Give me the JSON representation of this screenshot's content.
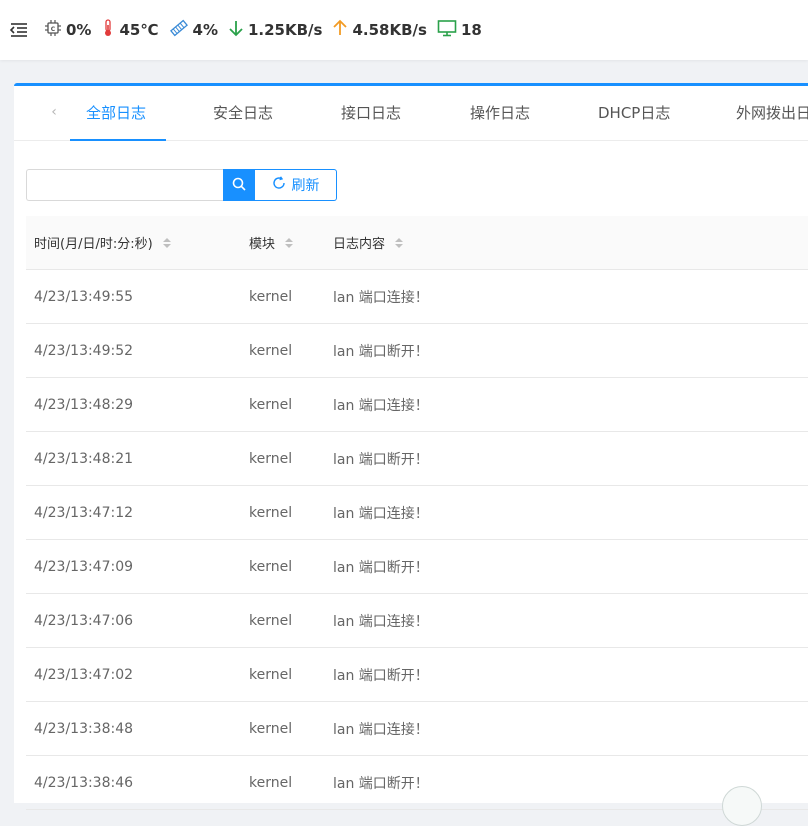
{
  "status_bar": {
    "cpu": "0%",
    "temperature": "45℃",
    "memory": "4%",
    "download": "1.25KB/s",
    "upload": "4.58KB/s",
    "devices": "18",
    "colors": {
      "temperature": "#e23b3b",
      "memory": "#3b8bd6",
      "download": "#2aa14a",
      "upload": "#f29b24",
      "devices": "#2aa14a"
    }
  },
  "tabs": [
    {
      "label": "全部日志",
      "active": true
    },
    {
      "label": "安全日志"
    },
    {
      "label": "接口日志"
    },
    {
      "label": "操作日志"
    },
    {
      "label": "DHCP日志"
    },
    {
      "label": "外网拨出日"
    }
  ],
  "search": {
    "value": "",
    "refresh_label": "刷新"
  },
  "table": {
    "columns": [
      "时间(月/日/时:分:秒)",
      "模块",
      "日志内容"
    ],
    "rows": [
      [
        "4/23/13:49:55",
        "kernel",
        "lan 端口连接！"
      ],
      [
        "4/23/13:49:52",
        "kernel",
        "lan 端口断开！"
      ],
      [
        "4/23/13:48:29",
        "kernel",
        "lan 端口连接！"
      ],
      [
        "4/23/13:48:21",
        "kernel",
        "lan 端口断开！"
      ],
      [
        "4/23/13:47:12",
        "kernel",
        "lan 端口连接！"
      ],
      [
        "4/23/13:47:09",
        "kernel",
        "lan 端口断开！"
      ],
      [
        "4/23/13:47:06",
        "kernel",
        "lan 端口连接！"
      ],
      [
        "4/23/13:47:02",
        "kernel",
        "lan 端口断开！"
      ],
      [
        "4/23/13:38:48",
        "kernel",
        "lan 端口连接！"
      ],
      [
        "4/23/13:38:46",
        "kernel",
        "lan 端口断开！"
      ]
    ]
  },
  "accent": "#1890ff"
}
